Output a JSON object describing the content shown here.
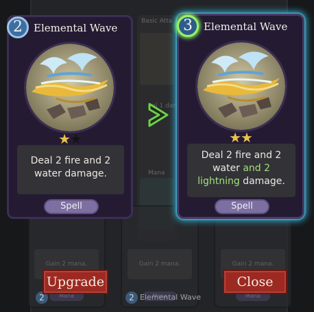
{
  "left_card": {
    "cost": "2",
    "title": "Elemental Wave",
    "stars_filled": 1,
    "stars_total": 2,
    "description": "Deal 2 fire and 2 water damage.",
    "type": "Spell"
  },
  "right_card": {
    "cost": "3",
    "title": "Elemental Wave",
    "stars_filled": 2,
    "stars_total": 2,
    "description_prefix": "Deal 2 fire and 2 water ",
    "description_highlight": "and 2 lightning",
    "description_suffix": " damage.",
    "type": "Spell"
  },
  "buttons": {
    "upgrade": "Upgrade",
    "close": "Close"
  },
  "background": {
    "mid_top_title": "Basic Atta",
    "mid_top_text": "eal 1 damag",
    "mid_bottom_title": "Mana",
    "bg_desc": "Gain 2 mana.",
    "bg_type": "Mana",
    "bottom_badge_left": "2",
    "bottom_badge_mid": "2",
    "bottom_title": "Elemental Wave"
  },
  "colors": {
    "highlight": "#9fe37e",
    "button": "#9c2a22",
    "glow": "#2ea6c9"
  }
}
